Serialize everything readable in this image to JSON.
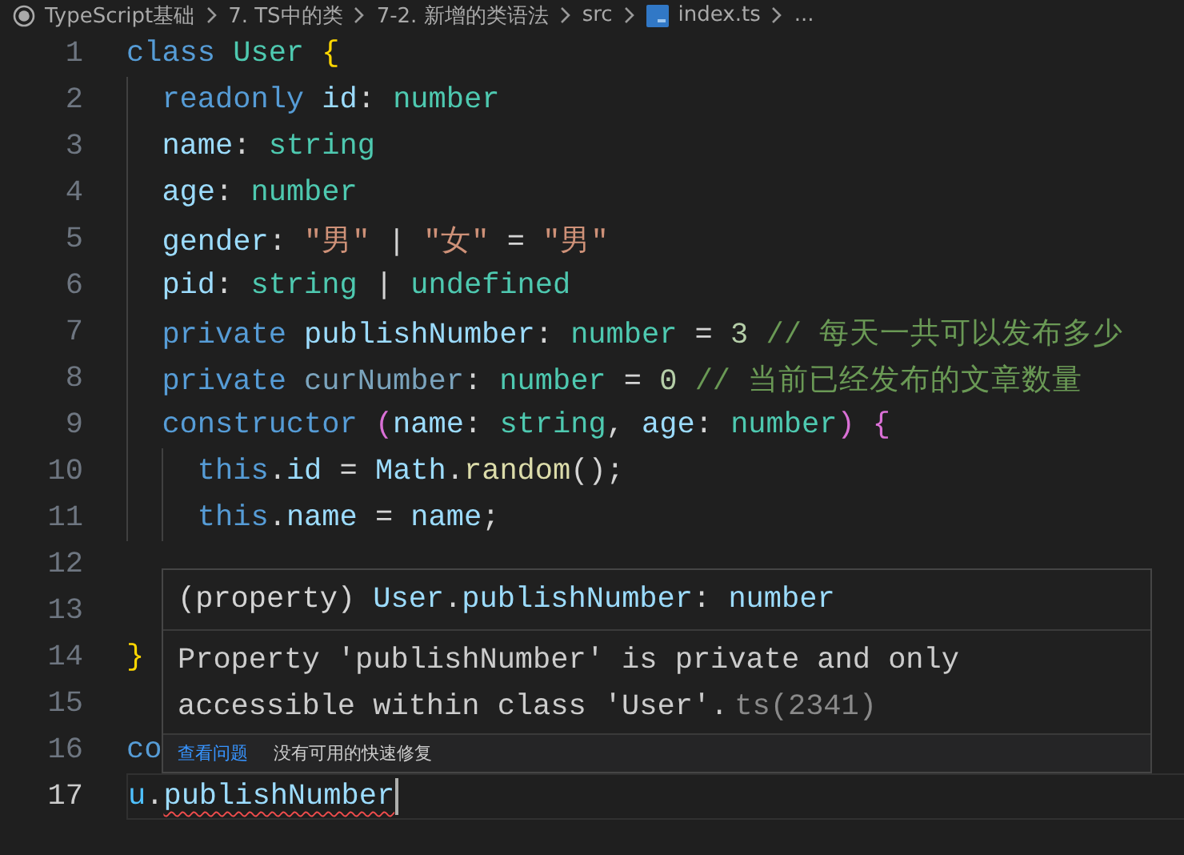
{
  "breadcrumbs": [
    {
      "text": "TypeScript基础",
      "kind": "folder"
    },
    {
      "text": "7. TS中的类",
      "kind": "folder"
    },
    {
      "text": "7-2. 新增的类语法",
      "kind": "folder"
    },
    {
      "text": "src",
      "kind": "folder"
    },
    {
      "text": "index.ts",
      "kind": "ts-file"
    },
    {
      "text": "...",
      "kind": "more"
    }
  ],
  "editor": {
    "lines": [
      {
        "number": "1",
        "active": false,
        "tokens": [
          {
            "text": "class ",
            "kind": "keyword"
          },
          {
            "text": "User ",
            "kind": "type"
          },
          {
            "text": "{",
            "kind": "brace"
          }
        ]
      },
      {
        "number": "2",
        "active": false,
        "tokens": [
          {
            "text": "  readonly ",
            "kind": "keyword"
          },
          {
            "text": "id",
            "kind": "property"
          },
          {
            "text": ": ",
            "kind": "plain"
          },
          {
            "text": "number",
            "kind": "type"
          }
        ]
      },
      {
        "number": "3",
        "active": false,
        "tokens": [
          {
            "text": "  name",
            "kind": "property"
          },
          {
            "text": ": ",
            "kind": "plain"
          },
          {
            "text": "string",
            "kind": "type"
          }
        ]
      },
      {
        "number": "4",
        "active": false,
        "tokens": [
          {
            "text": "  age",
            "kind": "property"
          },
          {
            "text": ": ",
            "kind": "plain"
          },
          {
            "text": "number",
            "kind": "type"
          }
        ]
      },
      {
        "number": "5",
        "active": false,
        "tokens": [
          {
            "text": "  gender",
            "kind": "property"
          },
          {
            "text": ": ",
            "kind": "plain"
          },
          {
            "text": "\"男\"",
            "kind": "string"
          },
          {
            "text": " | ",
            "kind": "plain"
          },
          {
            "text": "\"女\"",
            "kind": "string"
          },
          {
            "text": " = ",
            "kind": "plain"
          },
          {
            "text": "\"男\"",
            "kind": "string"
          }
        ]
      },
      {
        "number": "6",
        "active": false,
        "tokens": [
          {
            "text": "  pid",
            "kind": "property"
          },
          {
            "text": ": ",
            "kind": "plain"
          },
          {
            "text": "string",
            "kind": "type"
          },
          {
            "text": " | ",
            "kind": "plain"
          },
          {
            "text": "undefined",
            "kind": "type"
          }
        ]
      },
      {
        "number": "7",
        "active": false,
        "tokens": [
          {
            "text": "  private ",
            "kind": "keyword"
          },
          {
            "text": "publishNumber",
            "kind": "property"
          },
          {
            "text": ": ",
            "kind": "plain"
          },
          {
            "text": "number",
            "kind": "type"
          },
          {
            "text": " = ",
            "kind": "plain"
          },
          {
            "text": "3",
            "kind": "number"
          },
          {
            "text": " // 每天一共可以发布多少",
            "kind": "comment"
          }
        ]
      },
      {
        "number": "8",
        "active": false,
        "tokens": [
          {
            "text": "  private ",
            "kind": "keyword"
          },
          {
            "text": "curNumber",
            "kind": "unused"
          },
          {
            "text": ": ",
            "kind": "plain"
          },
          {
            "text": "number",
            "kind": "type"
          },
          {
            "text": " = ",
            "kind": "plain"
          },
          {
            "text": "0",
            "kind": "number"
          },
          {
            "text": " // 当前已经发布的文章数量",
            "kind": "comment"
          }
        ]
      },
      {
        "number": "9",
        "active": false,
        "tokens": [
          {
            "text": "  constructor ",
            "kind": "keyword"
          },
          {
            "text": "(",
            "kind": "paren"
          },
          {
            "text": "name",
            "kind": "property"
          },
          {
            "text": ": ",
            "kind": "plain"
          },
          {
            "text": "string",
            "kind": "type"
          },
          {
            "text": ", ",
            "kind": "plain"
          },
          {
            "text": "age",
            "kind": "property"
          },
          {
            "text": ": ",
            "kind": "plain"
          },
          {
            "text": "number",
            "kind": "type"
          },
          {
            "text": ")",
            "kind": "paren"
          },
          {
            "text": " {",
            "kind": "paren"
          }
        ]
      },
      {
        "number": "10",
        "active": false,
        "tokens": [
          {
            "text": "    this",
            "kind": "keyword"
          },
          {
            "text": ".",
            "kind": "plain"
          },
          {
            "text": "id",
            "kind": "property"
          },
          {
            "text": " = ",
            "kind": "plain"
          },
          {
            "text": "Math",
            "kind": "property"
          },
          {
            "text": ".",
            "kind": "plain"
          },
          {
            "text": "random",
            "kind": "function"
          },
          {
            "text": "();",
            "kind": "plain"
          }
        ]
      },
      {
        "number": "11",
        "active": false,
        "tokens": [
          {
            "text": "    this",
            "kind": "keyword"
          },
          {
            "text": ".",
            "kind": "plain"
          },
          {
            "text": "name",
            "kind": "property"
          },
          {
            "text": " = ",
            "kind": "plain"
          },
          {
            "text": "name",
            "kind": "property"
          },
          {
            "text": ";",
            "kind": "plain"
          }
        ]
      },
      {
        "number": "12",
        "active": false
      },
      {
        "number": "13",
        "active": false
      },
      {
        "number": "14",
        "active": false,
        "tokens": [
          {
            "text": "}",
            "kind": "brace"
          }
        ]
      },
      {
        "number": "15",
        "active": false
      },
      {
        "number": "16",
        "active": false,
        "tokens": [
          {
            "text": "co",
            "kind": "keyword"
          }
        ]
      },
      {
        "number": "17",
        "active": true,
        "tokens": [
          {
            "text": "u",
            "kind": "variable"
          },
          {
            "text": ".",
            "kind": "plain"
          },
          {
            "text": "publishNumber",
            "kind": "error"
          }
        ]
      }
    ]
  },
  "hover": {
    "signature": [
      {
        "text": "(property) ",
        "kind": "plain"
      },
      {
        "text": "User",
        "kind": "property"
      },
      {
        "text": ".",
        "kind": "plain"
      },
      {
        "text": "publishNumber",
        "kind": "property"
      },
      {
        "text": ": ",
        "kind": "plain"
      },
      {
        "text": "number",
        "kind": "property"
      }
    ],
    "message": "Property 'publishNumber' is private and only accessible within class 'User'.",
    "code": "ts(2341)",
    "link": "查看问题",
    "note": "没有可用的快速修复"
  }
}
